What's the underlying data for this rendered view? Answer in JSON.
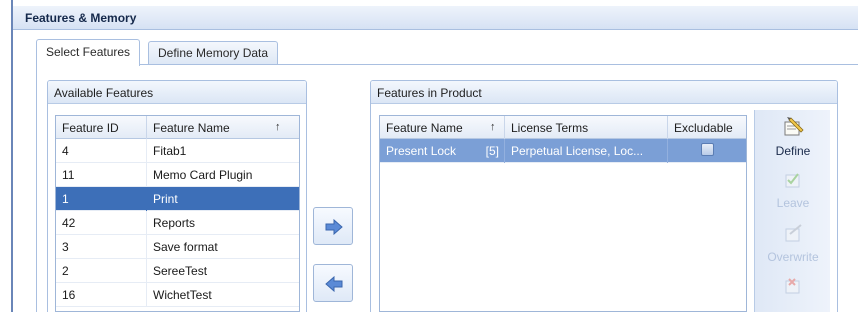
{
  "window": {
    "title": "Features & Memory"
  },
  "tabs": [
    {
      "label": "Select Features",
      "active": true
    },
    {
      "label": "Define Memory Data",
      "active": false
    }
  ],
  "available": {
    "group_title": "Available Features",
    "columns": [
      "Feature ID",
      "Feature Name"
    ],
    "sort_column": "Feature Name",
    "rows": [
      {
        "id": "4",
        "name": "Fitab1",
        "selected": false
      },
      {
        "id": "11",
        "name": "Memo Card Plugin",
        "selected": false
      },
      {
        "id": "1",
        "name": "Print",
        "selected": true
      },
      {
        "id": "42",
        "name": "Reports",
        "selected": false
      },
      {
        "id": "3",
        "name": "Save format",
        "selected": false
      },
      {
        "id": "2",
        "name": "SereeTest",
        "selected": false
      },
      {
        "id": "16",
        "name": "WichetTest",
        "selected": false
      }
    ]
  },
  "move_buttons": {
    "add_icon": "right-arrow-icon",
    "remove_icon": "left-arrow-icon"
  },
  "product": {
    "group_title": "Features in Product",
    "columns": [
      "Feature Name",
      "License Terms",
      "Excludable"
    ],
    "sort_column": "Feature Name",
    "rows": [
      {
        "name": "Present Lock",
        "count": "[5]",
        "license": "Perpetual License, Loc...",
        "excludable": false,
        "selected": true
      }
    ]
  },
  "actions": [
    {
      "label": "Define",
      "icon": "define-icon",
      "enabled": true
    },
    {
      "label": "Leave",
      "icon": "leave-icon",
      "enabled": false
    },
    {
      "label": "Overwrite",
      "icon": "overwrite-icon",
      "enabled": false
    },
    {
      "label": "",
      "icon": "remove-icon",
      "enabled": false
    }
  ],
  "colors": {
    "selection": "#3d6fb8",
    "selection_soft": "#7b9fd6",
    "border": "#a9bfe0",
    "arrow": "#5b8ad6"
  }
}
